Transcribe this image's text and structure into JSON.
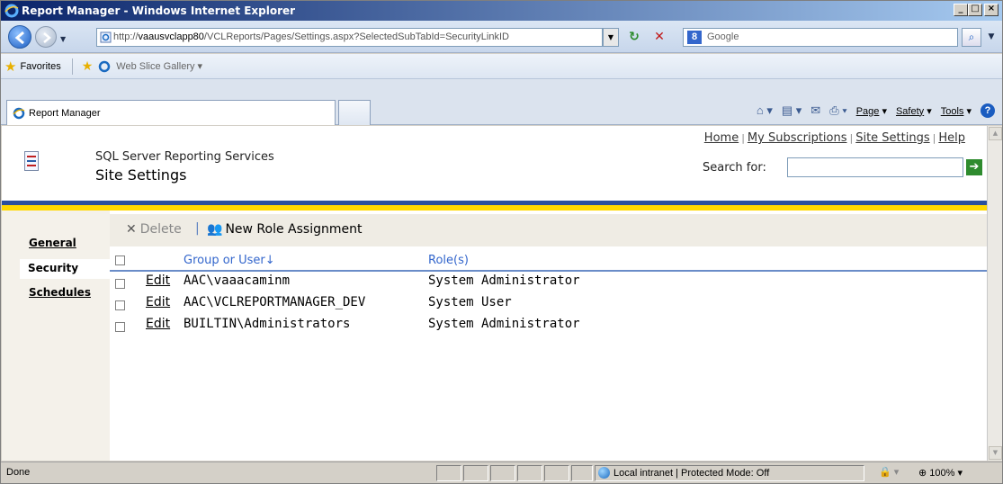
{
  "browser": {
    "title": "Report Manager - Windows Internet Explorer",
    "url_prefix": "http://",
    "url_host": "vaausvclapp80",
    "url_path": "/VCLReports/Pages/Settings.aspx?SelectedSubTabId=SecurityLinkID",
    "search_placeholder": "Google",
    "favorites_label": "Favorites",
    "web_slice_gallery": "Web Slice Gallery ▾",
    "tab_title": "Report Manager",
    "commands": {
      "page": "Page",
      "safety": "Safety",
      "tools": "Tools"
    },
    "status": "Done",
    "zone": "Local intranet | Protected Mode: Off",
    "zoom": "100%"
  },
  "page": {
    "header_links": [
      "Home",
      "My Subscriptions",
      "Site Settings",
      "Help"
    ],
    "app_name": "SQL Server Reporting Services",
    "title": "Site Settings",
    "search_label": "Search for:",
    "nav": {
      "general": "General",
      "security": "Security",
      "schedules": "Schedules"
    },
    "toolbar": {
      "delete": "Delete",
      "new_role_assignment": "New Role Assignment"
    },
    "table": {
      "columns": [
        "Group or User↓",
        "Role(s)"
      ],
      "edit_label": "Edit",
      "rows": [
        {
          "user": "AAC\\vaaacaminm",
          "role": "System Administrator"
        },
        {
          "user": "AAC\\VCLREPORTMANAGER_DEV",
          "role": "System User"
        },
        {
          "user": "BUILTIN\\Administrators",
          "role": "System Administrator"
        }
      ]
    }
  }
}
